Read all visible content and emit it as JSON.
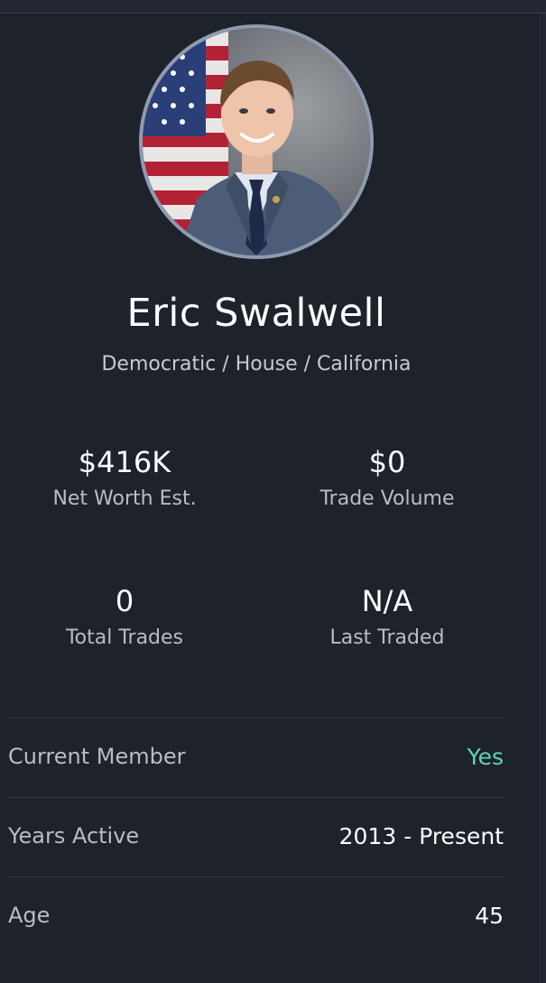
{
  "profile": {
    "name": "Eric Swalwell",
    "affiliation": "Democratic / House / California",
    "photo_icon": "portrait-photo"
  },
  "stats": [
    {
      "value": "$416K",
      "label": "Net Worth Est."
    },
    {
      "value": "$0",
      "label": "Trade Volume"
    },
    {
      "value": "0",
      "label": "Total Trades"
    },
    {
      "value": "N/A",
      "label": "Last Traded"
    }
  ],
  "details": [
    {
      "label": "Current Member",
      "value": "Yes"
    },
    {
      "label": "Years Active",
      "value": "2013 - Present"
    },
    {
      "label": "Age",
      "value": "45"
    }
  ],
  "colors": {
    "background": "#1e222b",
    "accent_yes": "#5ed3b4",
    "muted_text": "#b8bcc6"
  }
}
